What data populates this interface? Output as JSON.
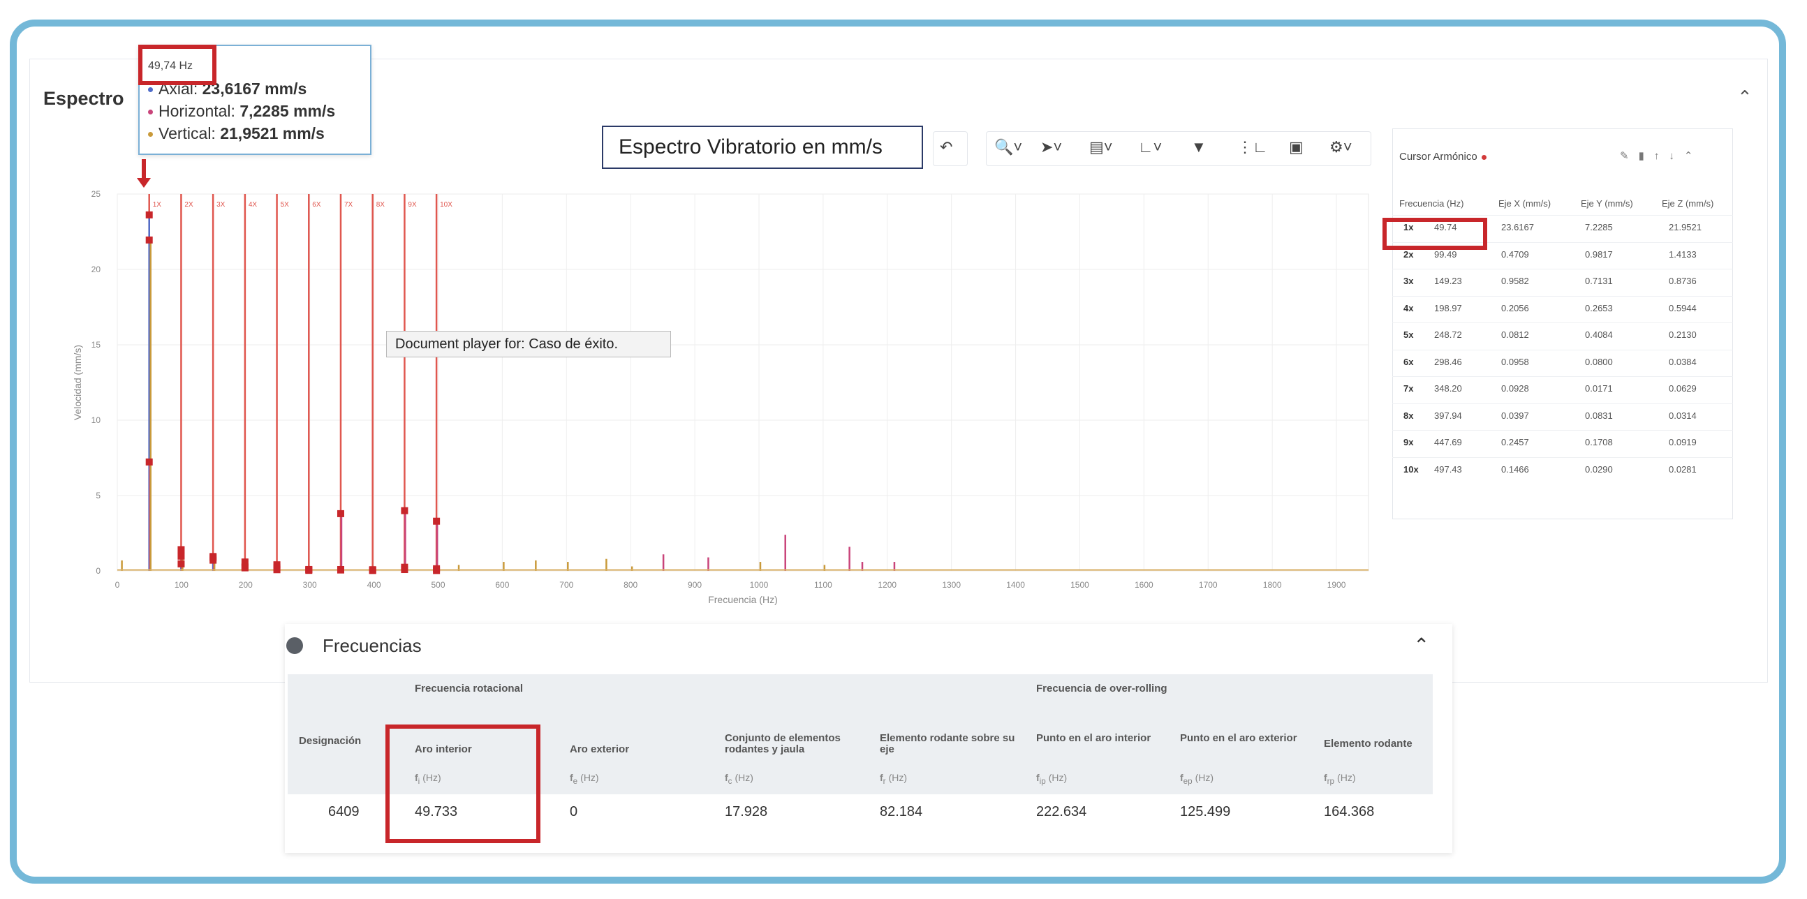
{
  "card": {
    "title": "Espectro"
  },
  "tooltip": {
    "freq": "49,74 Hz",
    "rows": [
      {
        "label": "Axial:",
        "value": "23,6167 mm/s",
        "color": "#4f6cc9"
      },
      {
        "label": "Horizontal:",
        "value": "7,2285 mm/s",
        "color": "#c9447a"
      },
      {
        "label": "Vertical:",
        "value": "21,9521 mm/s",
        "color": "#c99a3a"
      }
    ]
  },
  "chart_title": "Espectro Vibratorio en mm/s",
  "toolbar_icons": [
    "undo-icon",
    "zoom-icon",
    "pointer-icon",
    "select-icon",
    "line-chart-icon",
    "filter-icon",
    "scatter-icon",
    "comment-icon",
    "settings-icon"
  ],
  "chart_data": {
    "type": "bar",
    "xlabel": "Frecuencia (Hz)",
    "ylabel": "Velocidad (mm/s)",
    "xlim": [
      0,
      1950
    ],
    "ylim": [
      0,
      25
    ],
    "x_ticks": [
      0,
      100,
      200,
      300,
      400,
      500,
      600,
      700,
      800,
      900,
      1000,
      1100,
      1200,
      1300,
      1400,
      1500,
      1600,
      1700,
      1800,
      1900
    ],
    "y_ticks": [
      0,
      5,
      10,
      15,
      20,
      25
    ],
    "harmonic_cursors": [
      49.74,
      99.49,
      149.23,
      198.97,
      248.72,
      298.46,
      348.2,
      397.94,
      447.69,
      497.43
    ],
    "harmonic_labels": [
      "1X",
      "2X",
      "3X",
      "4X",
      "5X",
      "6X",
      "7X",
      "8X",
      "9X",
      "10X"
    ],
    "series": [
      {
        "name": "Axial",
        "color": "#4f6cc9",
        "points": [
          [
            49.74,
            23.6167
          ],
          [
            99.49,
            0.4709
          ],
          [
            149.23,
            0.9582
          ],
          [
            198.97,
            0.2056
          ],
          [
            248.72,
            0.0812
          ],
          [
            298.46,
            0.0958
          ],
          [
            348.2,
            0.0928
          ],
          [
            397.94,
            0.0397
          ],
          [
            447.69,
            0.2457
          ],
          [
            497.43,
            0.1466
          ]
        ]
      },
      {
        "name": "Horizontal",
        "color": "#c9447a",
        "points": [
          [
            49.74,
            7.2285
          ],
          [
            99.49,
            0.9817
          ],
          [
            149.23,
            0.7131
          ],
          [
            198.97,
            0.2653
          ],
          [
            248.72,
            0.4084
          ],
          [
            298.46,
            0.08
          ],
          [
            348.2,
            3.8
          ],
          [
            397.94,
            0.0831
          ],
          [
            447.69,
            4.0
          ],
          [
            497.43,
            3.3
          ],
          [
            850,
            1.1
          ],
          [
            920,
            0.9
          ],
          [
            1040,
            2.4
          ],
          [
            1140,
            1.6
          ],
          [
            1160,
            0.6
          ],
          [
            1210,
            0.6
          ]
        ]
      },
      {
        "name": "Vertical",
        "color": "#c99a3a",
        "points": [
          [
            5,
            0.7
          ],
          [
            49.74,
            21.9521
          ],
          [
            99.49,
            1.4133
          ],
          [
            149.23,
            0.8736
          ],
          [
            198.97,
            0.5944
          ],
          [
            248.72,
            0.213
          ],
          [
            298.46,
            0.0384
          ],
          [
            348.2,
            0.0629
          ],
          [
            397.94,
            0.0314
          ],
          [
            447.69,
            0.0919
          ],
          [
            497.43,
            0.0281
          ],
          [
            530,
            0.4
          ],
          [
            600,
            0.6
          ],
          [
            650,
            0.7
          ],
          [
            700,
            0.6
          ],
          [
            760,
            0.8
          ],
          [
            800,
            0.3
          ],
          [
            1000,
            0.6
          ],
          [
            1100,
            0.4
          ]
        ]
      }
    ]
  },
  "harmonic_table": {
    "title": "Cursor Armónico",
    "headers": [
      "Frecuencia (Hz)",
      "Eje X (mm/s)",
      "Eje Y (mm/s)",
      "Eje Z (mm/s)"
    ],
    "rows": [
      [
        "1x",
        "49.74",
        "23.6167",
        "7.2285",
        "21.9521"
      ],
      [
        "2x",
        "99.49",
        "0.4709",
        "0.9817",
        "1.4133"
      ],
      [
        "3x",
        "149.23",
        "0.9582",
        "0.7131",
        "0.8736"
      ],
      [
        "4x",
        "198.97",
        "0.2056",
        "0.2653",
        "0.5944"
      ],
      [
        "5x",
        "248.72",
        "0.0812",
        "0.4084",
        "0.2130"
      ],
      [
        "6x",
        "298.46",
        "0.0958",
        "0.0800",
        "0.0384"
      ],
      [
        "7x",
        "348.20",
        "0.0928",
        "0.0171",
        "0.0629"
      ],
      [
        "8x",
        "397.94",
        "0.0397",
        "0.0831",
        "0.0314"
      ],
      [
        "9x",
        "447.69",
        "0.2457",
        "0.1708",
        "0.0919"
      ],
      [
        "10x",
        "497.43",
        "0.1466",
        "0.0290",
        "0.0281"
      ]
    ]
  },
  "doc_tooltip": "Document player for: Caso de éxito.",
  "frequencies": {
    "title": "Frecuencias",
    "group_rotational": "Frecuencia rotacional",
    "group_overrolling": "Frecuencia de over-rolling",
    "col_designation": "Designación",
    "columns": [
      {
        "label": "Aro interior",
        "unit_sym": "f",
        "unit_sub": "i",
        "unit": "(Hz)",
        "value": "49.733"
      },
      {
        "label": "Aro exterior",
        "unit_sym": "f",
        "unit_sub": "e",
        "unit": "(Hz)",
        "value": "0"
      },
      {
        "label": "Conjunto de elementos rodantes y jaula",
        "unit_sym": "f",
        "unit_sub": "c",
        "unit": "(Hz)",
        "value": "17.928"
      },
      {
        "label": "Elemento rodante sobre su eje",
        "unit_sym": "f",
        "unit_sub": "r",
        "unit": "(Hz)",
        "value": "82.184"
      },
      {
        "label": "Punto en el aro interior",
        "unit_sym": "f",
        "unit_sub": "ip",
        "unit": "(Hz)",
        "value": "222.634"
      },
      {
        "label": "Punto en el aro exterior",
        "unit_sym": "f",
        "unit_sub": "ep",
        "unit": "(Hz)",
        "value": "125.499"
      },
      {
        "label": "Elemento rodante",
        "unit_sym": "f",
        "unit_sub": "rp",
        "unit": "(Hz)",
        "value": "164.368"
      }
    ],
    "designation": "6409"
  }
}
